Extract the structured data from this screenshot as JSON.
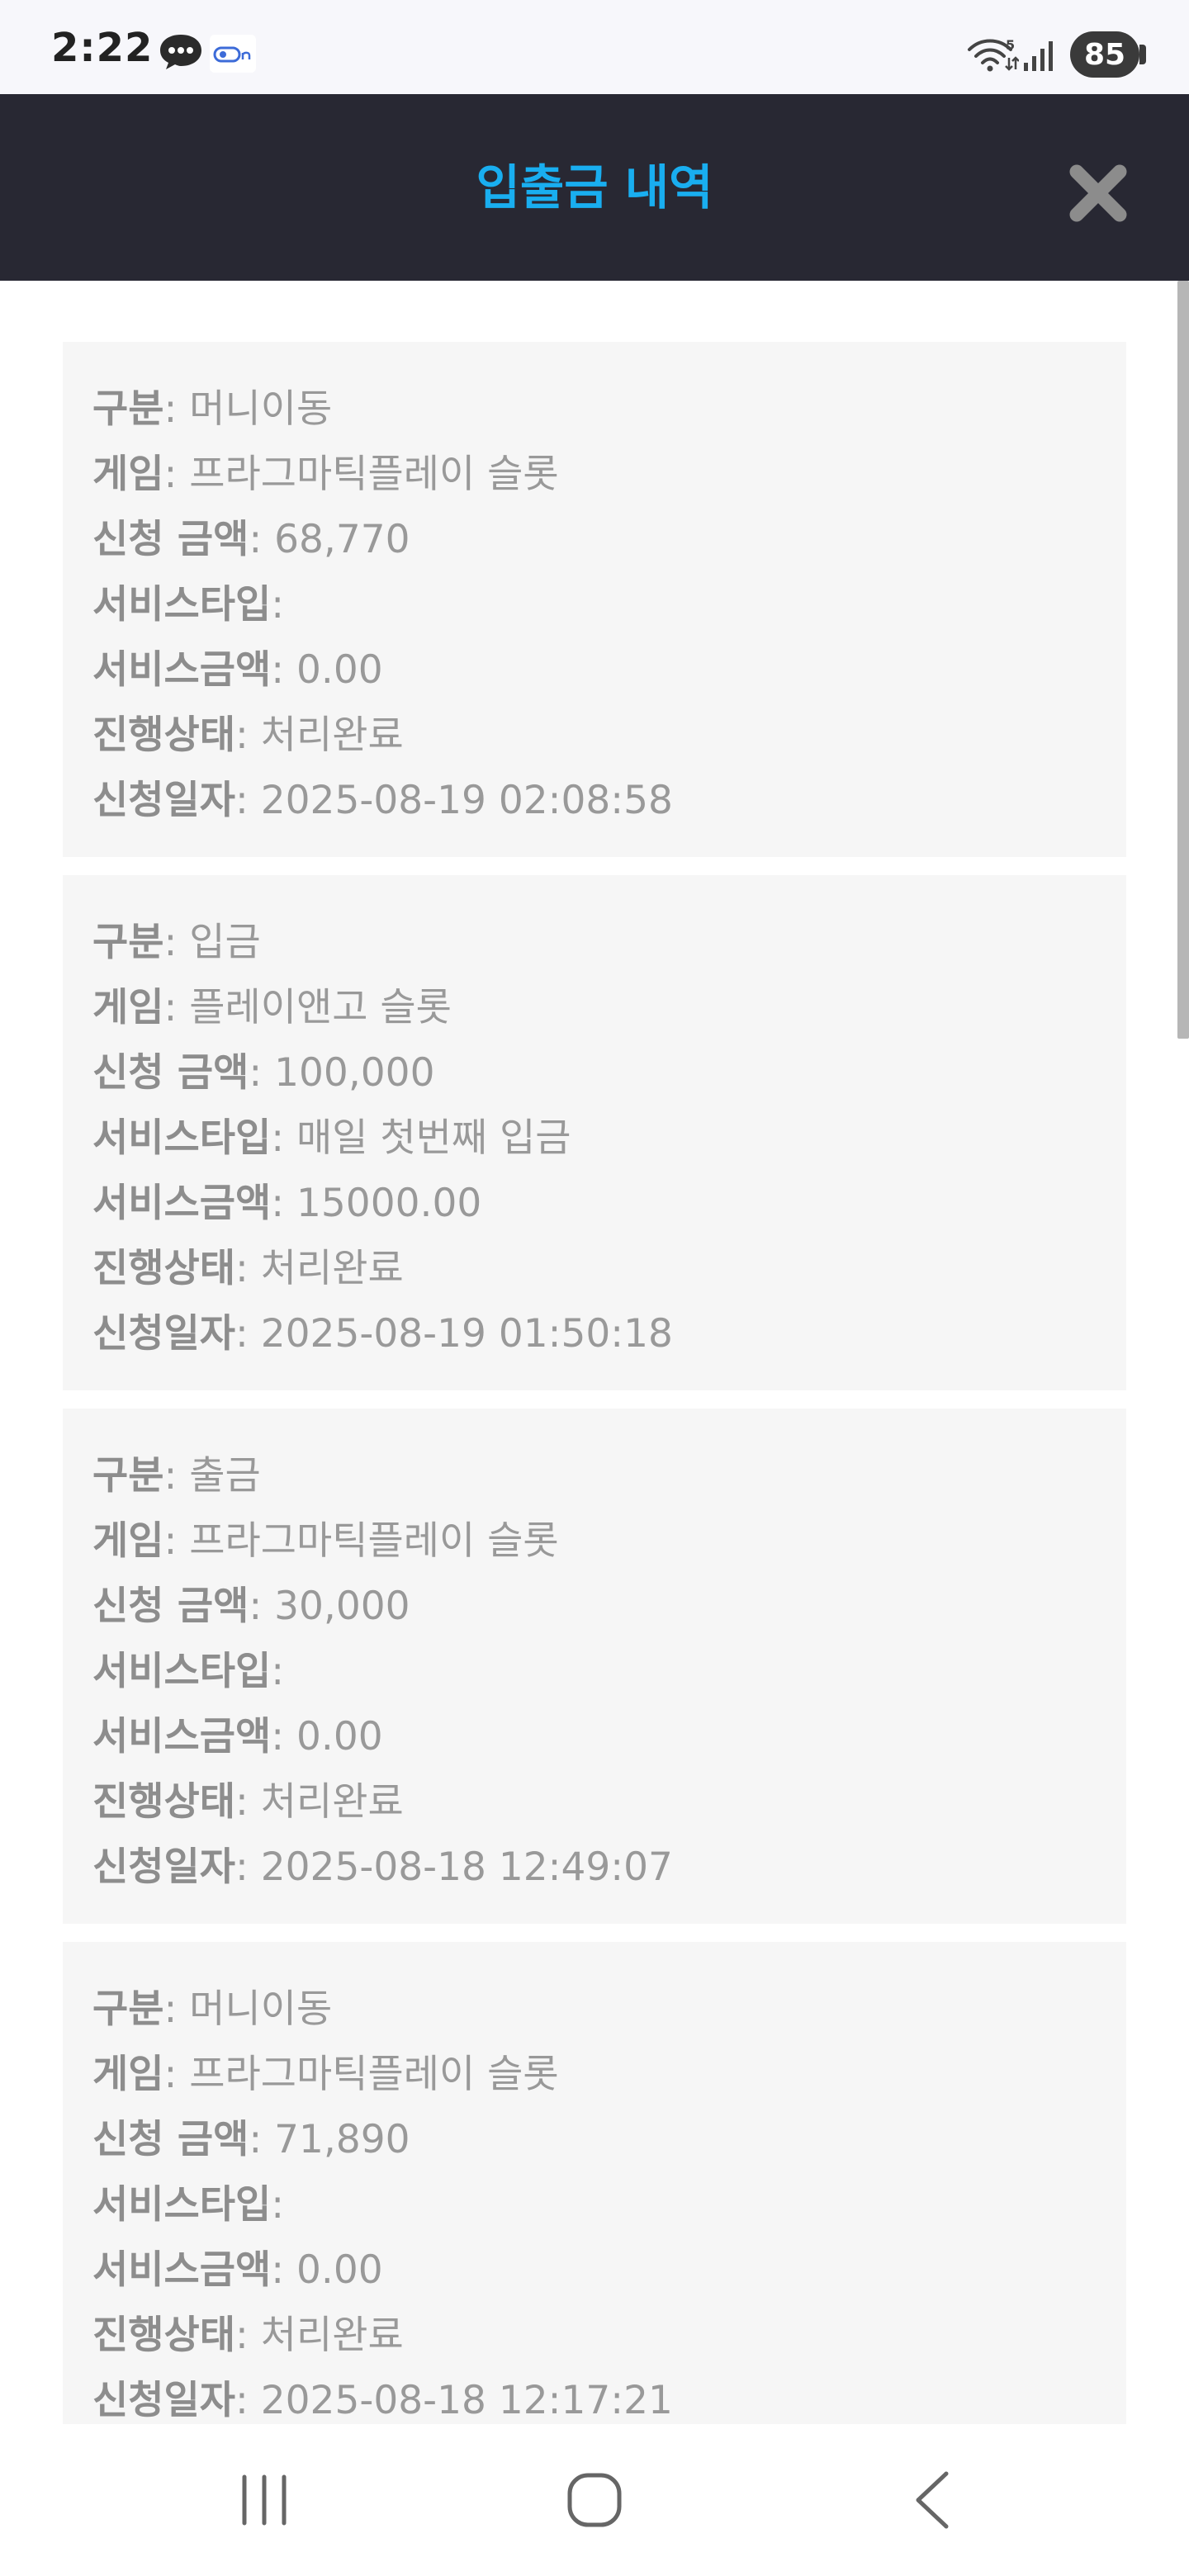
{
  "status_bar": {
    "time": "2:22",
    "battery": "85",
    "wifi_badge": "5"
  },
  "header": {
    "title": "입출금 내역"
  },
  "labels": {
    "category": "구분",
    "game": "게임",
    "amount": "신청 금액",
    "service_type": "서비스타입",
    "service_amount": "서비스금액",
    "status": "진행상태",
    "date": "신청일자",
    "separator": ": "
  },
  "records": [
    {
      "category": "머니이동",
      "game": "프라그마틱플레이 슬롯",
      "amount": "68,770",
      "service_type": "",
      "service_amount": "0.00",
      "status": "처리완료",
      "date": "2025-08-19 02:08:58"
    },
    {
      "category": "입금",
      "game": "플레이앤고 슬롯",
      "amount": "100,000",
      "service_type": "매일 첫번째 입금",
      "service_amount": "15000.00",
      "status": "처리완료",
      "date": "2025-08-19 01:50:18"
    },
    {
      "category": "출금",
      "game": "프라그마틱플레이 슬롯",
      "amount": "30,000",
      "service_type": "",
      "service_amount": "0.00",
      "status": "처리완료",
      "date": "2025-08-18 12:49:07"
    },
    {
      "category": "머니이동",
      "game": "프라그마틱플레이 슬롯",
      "amount": "71,890",
      "service_type": "",
      "service_amount": "0.00",
      "status": "처리완료",
      "date": "2025-08-18 12:17:21"
    }
  ],
  "icons": {
    "chat": "chat-bubble-icon",
    "camera": "camera-link-icon",
    "wifi": "wifi-icon",
    "signal": "signal-icon",
    "close": "close-icon",
    "recent_apps": "recent-apps-icon",
    "home": "home-icon",
    "back": "back-icon"
  },
  "colors": {
    "header_bg": "#282833",
    "title": "#19aef0",
    "card_bg": "#f6f6f6",
    "text": "#999999",
    "close": "#8c8c8c"
  }
}
